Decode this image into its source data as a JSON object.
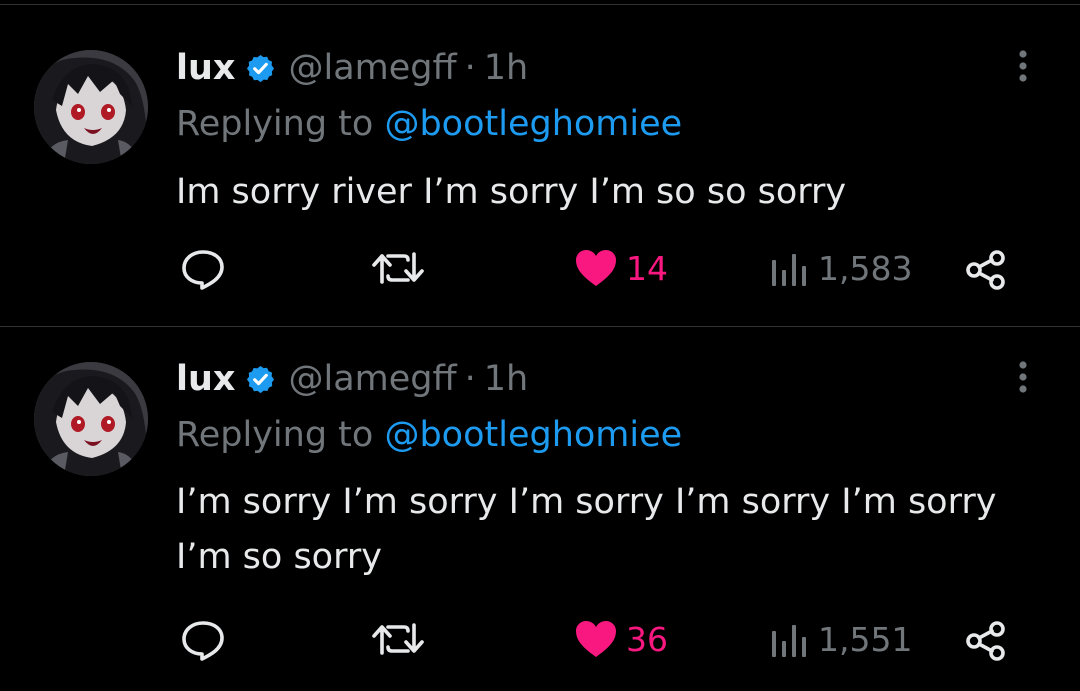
{
  "colors": {
    "background": "#000000",
    "divider": "#2f3336",
    "text_primary": "#e7e9ea",
    "text_secondary": "#71767b",
    "link": "#1d9bf0",
    "like_active": "#f91880",
    "verified_badge": "#1d9bf0"
  },
  "tweets": [
    {
      "author_name": "lux",
      "verified": true,
      "handle": "@lamegff",
      "separator": "·",
      "time": "1h",
      "replying_prefix": "Replying to",
      "replying_to": "@bootleghomiee",
      "text": "Im sorry river I’m sorry I’m so so sorry",
      "actions": {
        "reply_icon": "reply-bubble-icon",
        "retweet_icon": "retweet-icon",
        "like_icon": "heart-filled-icon",
        "like_count": "14",
        "views_icon": "views-bar-chart-icon",
        "view_count": "1,583",
        "share_icon": "share-icon"
      }
    },
    {
      "author_name": "lux",
      "verified": true,
      "handle": "@lamegff",
      "separator": "·",
      "time": "1h",
      "replying_prefix": "Replying to",
      "replying_to": "@bootleghomiee",
      "text": "I’m sorry I’m sorry I’m sorry I’m sorry I’m sorry I’m so sorry",
      "actions": {
        "reply_icon": "reply-bubble-icon",
        "retweet_icon": "retweet-icon",
        "like_icon": "heart-filled-icon",
        "like_count": "36",
        "views_icon": "views-bar-chart-icon",
        "view_count": "1,551",
        "share_icon": "share-icon"
      }
    }
  ]
}
